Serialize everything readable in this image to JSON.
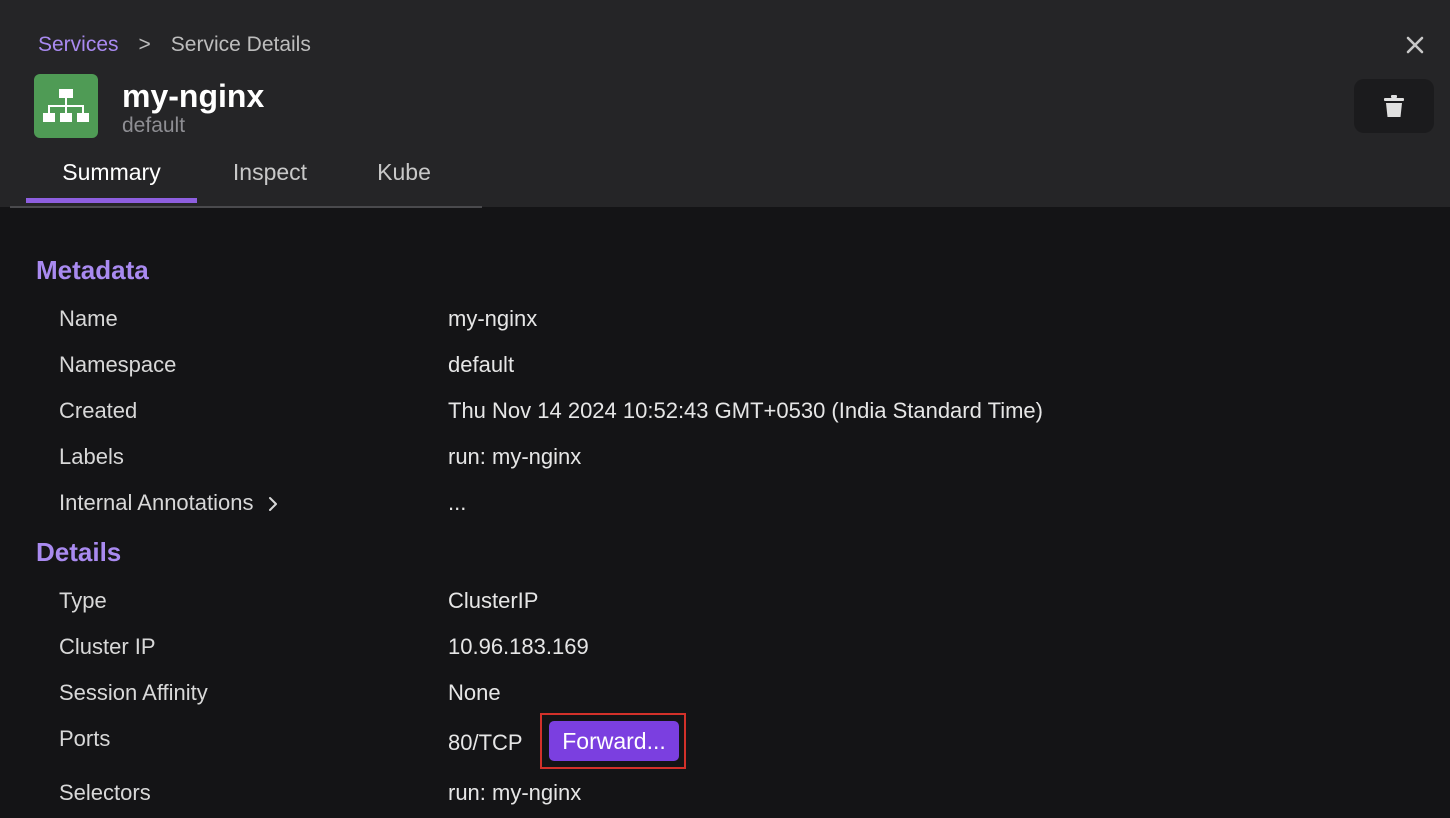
{
  "breadcrumb": {
    "parent": "Services",
    "separator": ">",
    "current": "Service Details"
  },
  "resource": {
    "name": "my-nginx",
    "namespace": "default",
    "icon": "service-network-icon",
    "icon_color": "#4f9b55"
  },
  "tabs": [
    {
      "label": "Summary",
      "active": true
    },
    {
      "label": "Inspect",
      "active": false
    },
    {
      "label": "Kube",
      "active": false
    }
  ],
  "metadata": {
    "title": "Metadata",
    "rows": [
      {
        "label": "Name",
        "value": "my-nginx"
      },
      {
        "label": "Namespace",
        "value": "default"
      },
      {
        "label": "Created",
        "value": "Thu Nov 14 2024 10:52:43 GMT+0530 (India Standard Time)"
      },
      {
        "label": "Labels",
        "value": "run: my-nginx"
      },
      {
        "label": "Internal Annotations",
        "value": "..."
      }
    ]
  },
  "details": {
    "title": "Details",
    "rows": [
      {
        "label": "Type",
        "value": "ClusterIP"
      },
      {
        "label": "Cluster IP",
        "value": "10.96.183.169"
      },
      {
        "label": "Session Affinity",
        "value": "None"
      },
      {
        "label": "Ports",
        "value": "80/TCP"
      },
      {
        "label": "Selectors",
        "value": "run: my-nginx"
      }
    ],
    "forward_button": "Forward..."
  },
  "colors": {
    "accent": "#a98af0",
    "button": "#7b3fe0",
    "highlight_border": "#d2312a"
  }
}
